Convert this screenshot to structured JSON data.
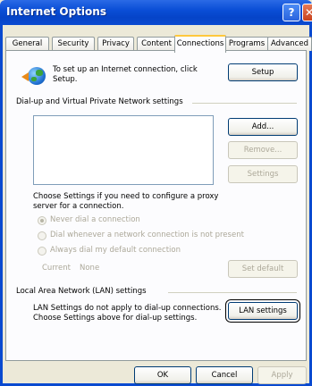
{
  "window": {
    "title": "Internet Options",
    "help_glyph": "?",
    "close_glyph": "✕"
  },
  "tabs": [
    {
      "label": "General"
    },
    {
      "label": "Security"
    },
    {
      "label": "Privacy"
    },
    {
      "label": "Content"
    },
    {
      "label": "Connections"
    },
    {
      "label": "Programs"
    },
    {
      "label": "Advanced"
    }
  ],
  "active_tab": "Connections",
  "setup_section": {
    "text_line1": "To set up an Internet connection, click",
    "text_line2": "Setup.",
    "setup_button": "Setup"
  },
  "dialup_section": {
    "heading": "Dial-up and Virtual Private Network settings",
    "add_button": "Add...",
    "remove_button": "Remove...",
    "settings_button": "Settings",
    "choose_text_line1": "Choose Settings if you need to configure a proxy",
    "choose_text_line2": "server for a connection.",
    "radio_never": "Never dial a connection",
    "radio_whenever": "Dial whenever a network connection is not present",
    "radio_always": "Always dial my default connection",
    "current_label": "Current",
    "current_value": "None",
    "set_default_button": "Set default"
  },
  "lan_section": {
    "heading": "Local Area Network (LAN) settings",
    "text_line1": "LAN Settings do not apply to dial-up connections.",
    "text_line2": "Choose Settings above for dial-up settings.",
    "lan_button": "LAN settings"
  },
  "footer": {
    "ok": "OK",
    "cancel": "Cancel",
    "apply": "Apply"
  },
  "colors": {
    "titlebar": "#0a4ed6",
    "dialog_bg": "#ece9d8",
    "panel_bg": "#fcfcfe"
  }
}
